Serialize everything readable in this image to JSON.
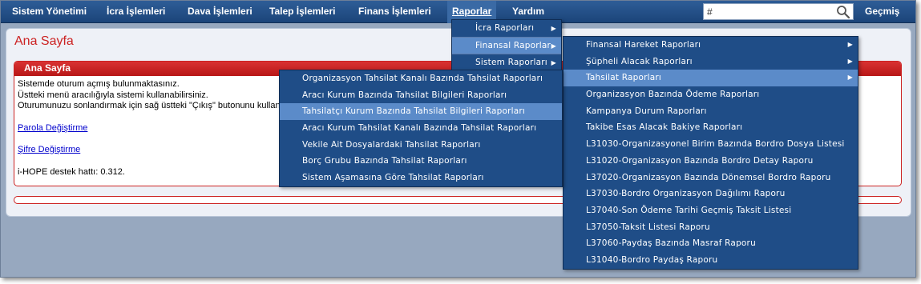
{
  "nav": {
    "items": [
      "Sistem Yönetimi",
      "İcra İşlemleri",
      "Dava İşlemleri",
      "Talep İşlemleri",
      "Finans İşlemleri",
      "Raporlar",
      "Yardım"
    ],
    "active": "Raporlar",
    "search_value": "#",
    "history_label": "Geçmiş"
  },
  "page": {
    "title": "Ana Sayfa",
    "panel": {
      "header": "Ana Sayfa",
      "lines": [
        "Sistemde oturum açmış bulunmaktasınız.",
        "Üstteki menü aracılığıyla sistemi kullanabilirsiniz.",
        "Oturumunuzu sonlandırmak için sağ üstteki \"Çıkış\" butonunu kullanak"
      ],
      "link_parola": "Parola Değiştirme",
      "link_sifre": "Şifre Değiştirme",
      "support": "i-HOPE destek hattı: 0.312."
    }
  },
  "menu_raporlar": {
    "items": [
      {
        "label": "İcra Raporları",
        "submenu": true
      },
      {
        "label": "Finansal Raporlar",
        "submenu": true,
        "highlighted": true
      },
      {
        "label": "Sistem Raporları",
        "submenu": true
      }
    ]
  },
  "menu_finansal": {
    "items": [
      {
        "label": "Finansal Hareket Raporları",
        "submenu": true
      },
      {
        "label": "Şüpheli Alacak Raporları",
        "submenu": true
      },
      {
        "label": "Tahsilat Raporları",
        "submenu": true,
        "highlighted": true
      },
      {
        "label": "Organizasyon Bazında Ödeme Raporları"
      },
      {
        "label": "Kampanya Durum Raporları"
      },
      {
        "label": "Takibe Esas Alacak Bakiye Raporları"
      },
      {
        "label": "L31030-Organizasyonel Birim Bazında Bordro Dosya Listesi"
      },
      {
        "label": "L31020-Organizasyon Bazında Bordro Detay Raporu"
      },
      {
        "label": "L37020-Organizasyon Bazında Dönemsel Bordro Raporu"
      },
      {
        "label": "L37030-Bordro Organizasyon Dağılımı Raporu"
      },
      {
        "label": "L37040-Son Ödeme Tarihi Geçmiş Taksit Listesi"
      },
      {
        "label": "L37050-Taksit Listesi Raporu"
      },
      {
        "label": "L37060-Paydaş Bazında Masraf Raporu"
      },
      {
        "label": "L31040-Bordro Paydaş Raporu"
      }
    ]
  },
  "menu_tahsilat": {
    "items": [
      {
        "label": "Organizasyon Tahsilat Kanalı Bazında Tahsilat Raporları"
      },
      {
        "label": "Aracı Kurum Bazında Tahsilat Bilgileri Raporları"
      },
      {
        "label": "Tahsilatçı Kurum Bazında Tahsilat Bilgileri Raporları",
        "highlighted": true
      },
      {
        "label": "Aracı Kurum Tahsilat Kanalı Bazında Tahsilat Raporları"
      },
      {
        "label": "Vekile Ait Dosyalardaki Tahsilat Raporları"
      },
      {
        "label": "Borç Grubu Bazında Tahsilat Raporları"
      },
      {
        "label": "Sistem Aşamasına Göre Tahsilat Raporları"
      }
    ]
  },
  "colors": {
    "nav_bg": "#1f4d87",
    "menu_bg": "#1f4d87",
    "menu_highlight": "#5b8bc9",
    "accent_red": "#cc2222"
  },
  "icons": [
    "search-icon",
    "chevron-right-icon"
  ]
}
